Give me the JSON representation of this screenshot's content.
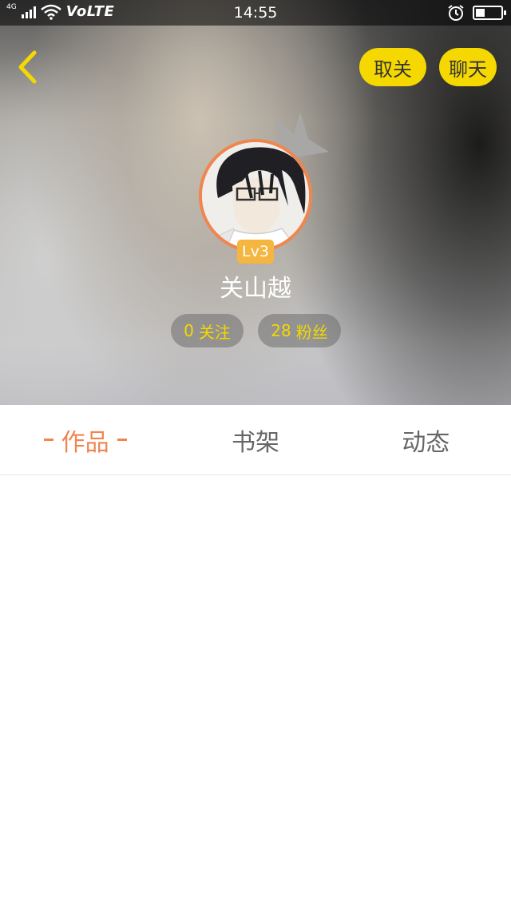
{
  "status_bar": {
    "network": "4G",
    "volte": "VoLTE",
    "time": "14:55",
    "icons": [
      "signal-icon",
      "wifi-icon",
      "alarm-icon",
      "battery-icon"
    ],
    "battery_level": 0.35
  },
  "header": {
    "back_icon": "chevron-left-icon",
    "unfollow_label": "取关",
    "chat_label": "聊天",
    "accent_color": "#f5d800"
  },
  "profile": {
    "level": "Lv3",
    "name": "关山越",
    "following_count": "0",
    "following_label": "关注",
    "fans_count": "28",
    "fans_label": "粉丝",
    "ring_color": "#f0854e"
  },
  "tabs": [
    {
      "label": "作品",
      "active": true
    },
    {
      "label": "书架",
      "active": false
    },
    {
      "label": "动态",
      "active": false
    }
  ]
}
